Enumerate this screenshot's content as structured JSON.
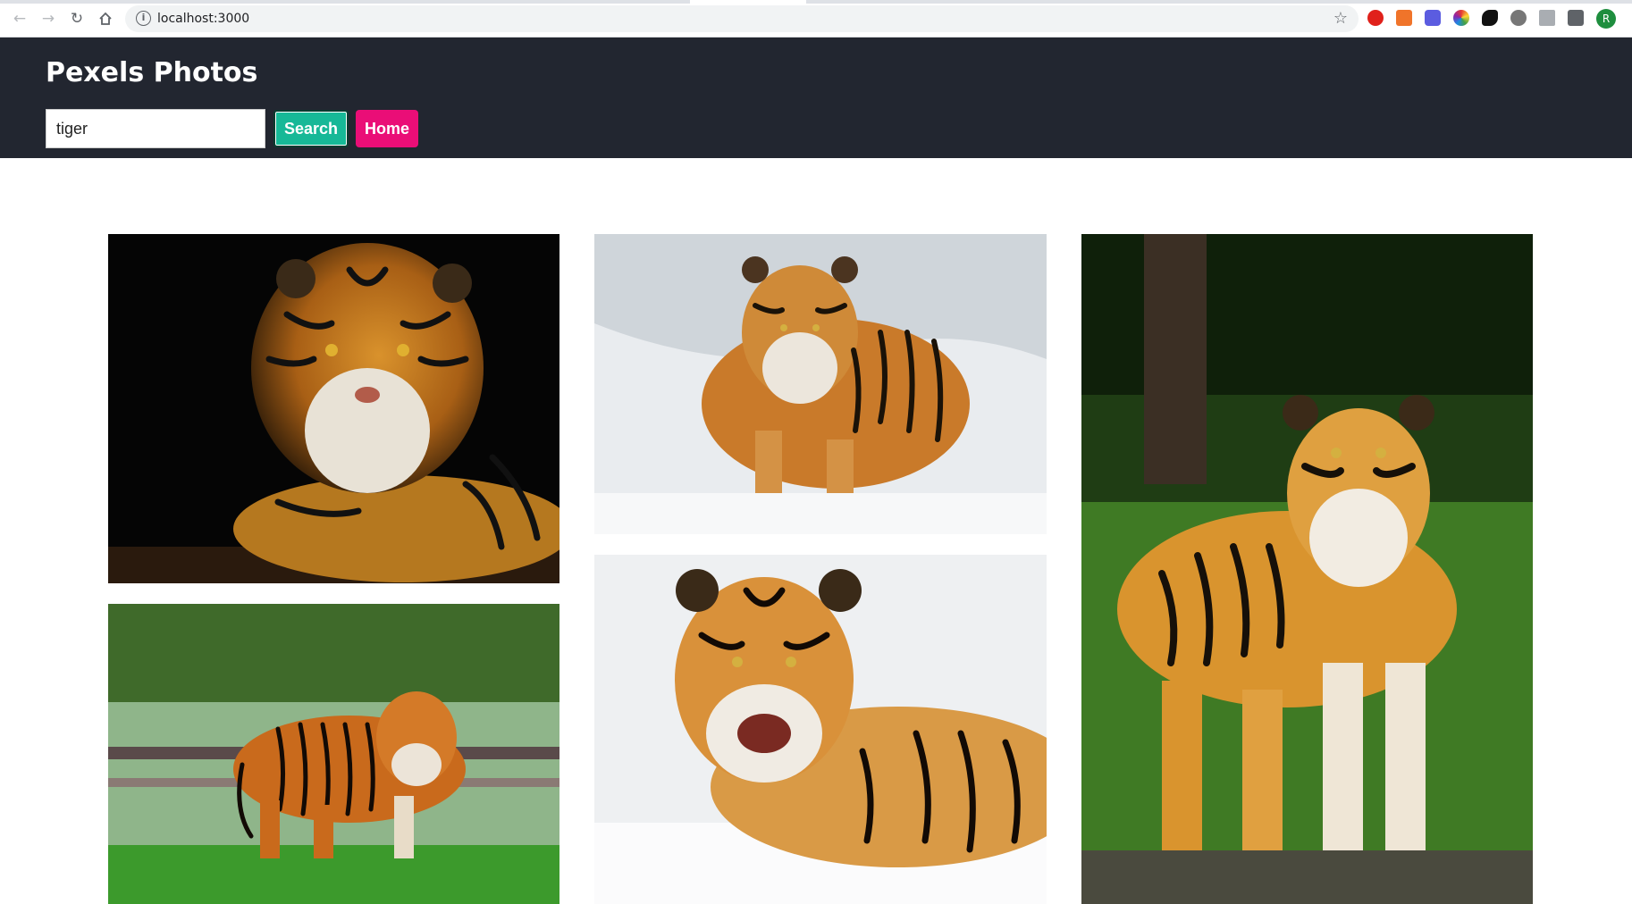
{
  "browser": {
    "url": "localhost:3000",
    "profile_initial": "R",
    "extension_icons": [
      "opera-icon",
      "megaphone-icon",
      "video-icon",
      "colorwheel-icon",
      "fish-icon",
      "globe-icon",
      "download-icon",
      "puzzle-icon"
    ]
  },
  "header": {
    "title": "Pexels Photos",
    "search_value": "tiger",
    "search_button": "Search",
    "home_button": "Home",
    "colors": {
      "background": "#222630",
      "search_button": "#17b897",
      "home_button": "#ea0e77"
    }
  },
  "gallery": {
    "photos": [
      {
        "name": "tiger-photo-1",
        "subject": "tiger lying on black background"
      },
      {
        "name": "tiger-photo-2",
        "subject": "tiger standing in snow"
      },
      {
        "name": "tiger-photo-3",
        "subject": "tiger standing on grass in forest"
      },
      {
        "name": "tiger-photo-4",
        "subject": "tiger walking on grass"
      },
      {
        "name": "tiger-photo-5",
        "subject": "tiger roaring in snow"
      }
    ]
  }
}
